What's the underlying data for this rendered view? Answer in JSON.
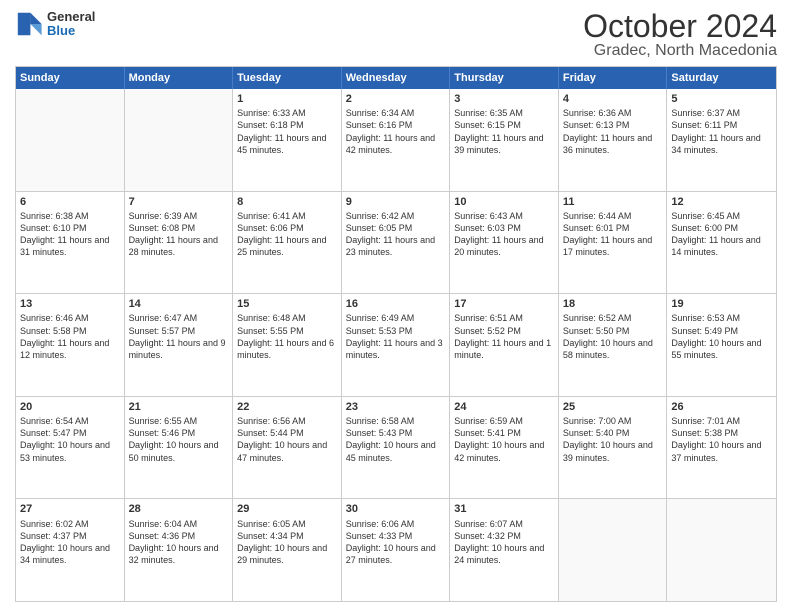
{
  "header": {
    "logo_line1": "General",
    "logo_line2": "Blue",
    "title": "October 2024",
    "subtitle": "Gradec, North Macedonia"
  },
  "days": [
    "Sunday",
    "Monday",
    "Tuesday",
    "Wednesday",
    "Thursday",
    "Friday",
    "Saturday"
  ],
  "weeks": [
    [
      {
        "num": "",
        "empty": true
      },
      {
        "num": "",
        "empty": true
      },
      {
        "num": "1",
        "sunrise": "6:33 AM",
        "sunset": "6:18 PM",
        "daylight": "11 hours and 45 minutes."
      },
      {
        "num": "2",
        "sunrise": "6:34 AM",
        "sunset": "6:16 PM",
        "daylight": "11 hours and 42 minutes."
      },
      {
        "num": "3",
        "sunrise": "6:35 AM",
        "sunset": "6:15 PM",
        "daylight": "11 hours and 39 minutes."
      },
      {
        "num": "4",
        "sunrise": "6:36 AM",
        "sunset": "6:13 PM",
        "daylight": "11 hours and 36 minutes."
      },
      {
        "num": "5",
        "sunrise": "6:37 AM",
        "sunset": "6:11 PM",
        "daylight": "11 hours and 34 minutes."
      }
    ],
    [
      {
        "num": "6",
        "sunrise": "6:38 AM",
        "sunset": "6:10 PM",
        "daylight": "11 hours and 31 minutes."
      },
      {
        "num": "7",
        "sunrise": "6:39 AM",
        "sunset": "6:08 PM",
        "daylight": "11 hours and 28 minutes."
      },
      {
        "num": "8",
        "sunrise": "6:41 AM",
        "sunset": "6:06 PM",
        "daylight": "11 hours and 25 minutes."
      },
      {
        "num": "9",
        "sunrise": "6:42 AM",
        "sunset": "6:05 PM",
        "daylight": "11 hours and 23 minutes."
      },
      {
        "num": "10",
        "sunrise": "6:43 AM",
        "sunset": "6:03 PM",
        "daylight": "11 hours and 20 minutes."
      },
      {
        "num": "11",
        "sunrise": "6:44 AM",
        "sunset": "6:01 PM",
        "daylight": "11 hours and 17 minutes."
      },
      {
        "num": "12",
        "sunrise": "6:45 AM",
        "sunset": "6:00 PM",
        "daylight": "11 hours and 14 minutes."
      }
    ],
    [
      {
        "num": "13",
        "sunrise": "6:46 AM",
        "sunset": "5:58 PM",
        "daylight": "11 hours and 12 minutes."
      },
      {
        "num": "14",
        "sunrise": "6:47 AM",
        "sunset": "5:57 PM",
        "daylight": "11 hours and 9 minutes."
      },
      {
        "num": "15",
        "sunrise": "6:48 AM",
        "sunset": "5:55 PM",
        "daylight": "11 hours and 6 minutes."
      },
      {
        "num": "16",
        "sunrise": "6:49 AM",
        "sunset": "5:53 PM",
        "daylight": "11 hours and 3 minutes."
      },
      {
        "num": "17",
        "sunrise": "6:51 AM",
        "sunset": "5:52 PM",
        "daylight": "11 hours and 1 minute."
      },
      {
        "num": "18",
        "sunrise": "6:52 AM",
        "sunset": "5:50 PM",
        "daylight": "10 hours and 58 minutes."
      },
      {
        "num": "19",
        "sunrise": "6:53 AM",
        "sunset": "5:49 PM",
        "daylight": "10 hours and 55 minutes."
      }
    ],
    [
      {
        "num": "20",
        "sunrise": "6:54 AM",
        "sunset": "5:47 PM",
        "daylight": "10 hours and 53 minutes."
      },
      {
        "num": "21",
        "sunrise": "6:55 AM",
        "sunset": "5:46 PM",
        "daylight": "10 hours and 50 minutes."
      },
      {
        "num": "22",
        "sunrise": "6:56 AM",
        "sunset": "5:44 PM",
        "daylight": "10 hours and 47 minutes."
      },
      {
        "num": "23",
        "sunrise": "6:58 AM",
        "sunset": "5:43 PM",
        "daylight": "10 hours and 45 minutes."
      },
      {
        "num": "24",
        "sunrise": "6:59 AM",
        "sunset": "5:41 PM",
        "daylight": "10 hours and 42 minutes."
      },
      {
        "num": "25",
        "sunrise": "7:00 AM",
        "sunset": "5:40 PM",
        "daylight": "10 hours and 39 minutes."
      },
      {
        "num": "26",
        "sunrise": "7:01 AM",
        "sunset": "5:38 PM",
        "daylight": "10 hours and 37 minutes."
      }
    ],
    [
      {
        "num": "27",
        "sunrise": "6:02 AM",
        "sunset": "4:37 PM",
        "daylight": "10 hours and 34 minutes."
      },
      {
        "num": "28",
        "sunrise": "6:04 AM",
        "sunset": "4:36 PM",
        "daylight": "10 hours and 32 minutes."
      },
      {
        "num": "29",
        "sunrise": "6:05 AM",
        "sunset": "4:34 PM",
        "daylight": "10 hours and 29 minutes."
      },
      {
        "num": "30",
        "sunrise": "6:06 AM",
        "sunset": "4:33 PM",
        "daylight": "10 hours and 27 minutes."
      },
      {
        "num": "31",
        "sunrise": "6:07 AM",
        "sunset": "4:32 PM",
        "daylight": "10 hours and 24 minutes."
      },
      {
        "num": "",
        "empty": true
      },
      {
        "num": "",
        "empty": true
      }
    ]
  ]
}
